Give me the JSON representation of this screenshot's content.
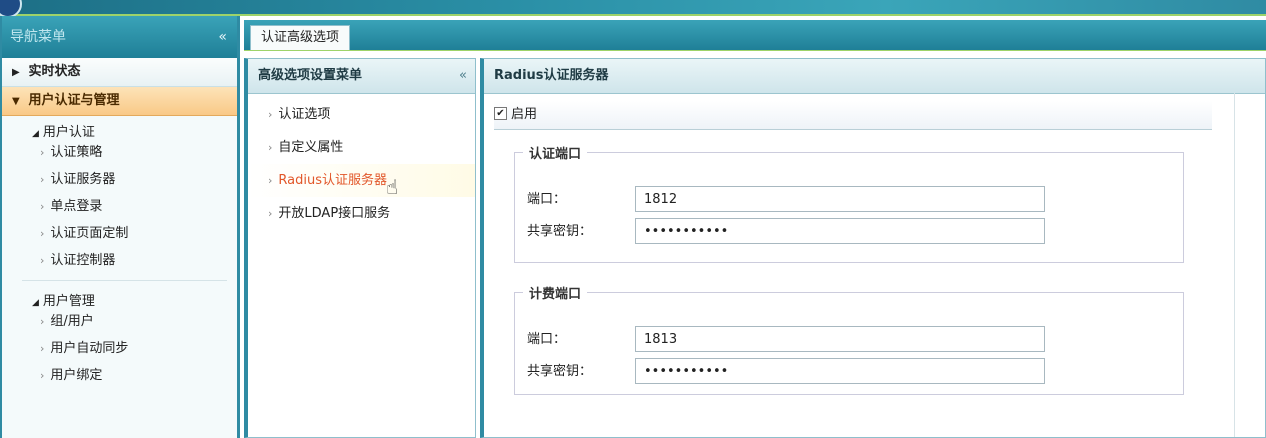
{
  "nav": {
    "title": "导航菜单",
    "collapse": "«",
    "groups": [
      {
        "label": "实时状态",
        "arrow": "▶"
      },
      {
        "label": "用户认证与管理",
        "arrow": "▼"
      }
    ],
    "auth_section": {
      "label": "用户认证",
      "items": [
        "认证策略",
        "认证服务器",
        "单点登录",
        "认证页面定制",
        "认证控制器"
      ]
    },
    "user_section": {
      "label": "用户管理",
      "items": [
        "组/用户",
        "用户自动同步",
        "用户绑定"
      ]
    }
  },
  "tabs": [
    {
      "label": "认证高级选项"
    }
  ],
  "mid_menu": {
    "title": "高级选项设置菜单",
    "collapse": "«",
    "items": [
      "认证选项",
      "自定义属性",
      "Radius认证服务器",
      "开放LDAP接口服务"
    ]
  },
  "content": {
    "title": "Radius认证服务器",
    "enable_label": "启用",
    "auth_port": {
      "legend": "认证端口",
      "port_label": "端口：",
      "port_value": "1812",
      "secret_label": "共享密钥：",
      "secret_value": "•••••••••••"
    },
    "acct_port": {
      "legend": "计费端口",
      "port_label": "端口：",
      "port_value": "1813",
      "secret_label": "共享密钥：",
      "secret_value": "•••••••••••"
    }
  },
  "colors": {
    "accent": "#2f8ba3",
    "active_group": "#f9c987",
    "active_link": "#e2572a"
  }
}
